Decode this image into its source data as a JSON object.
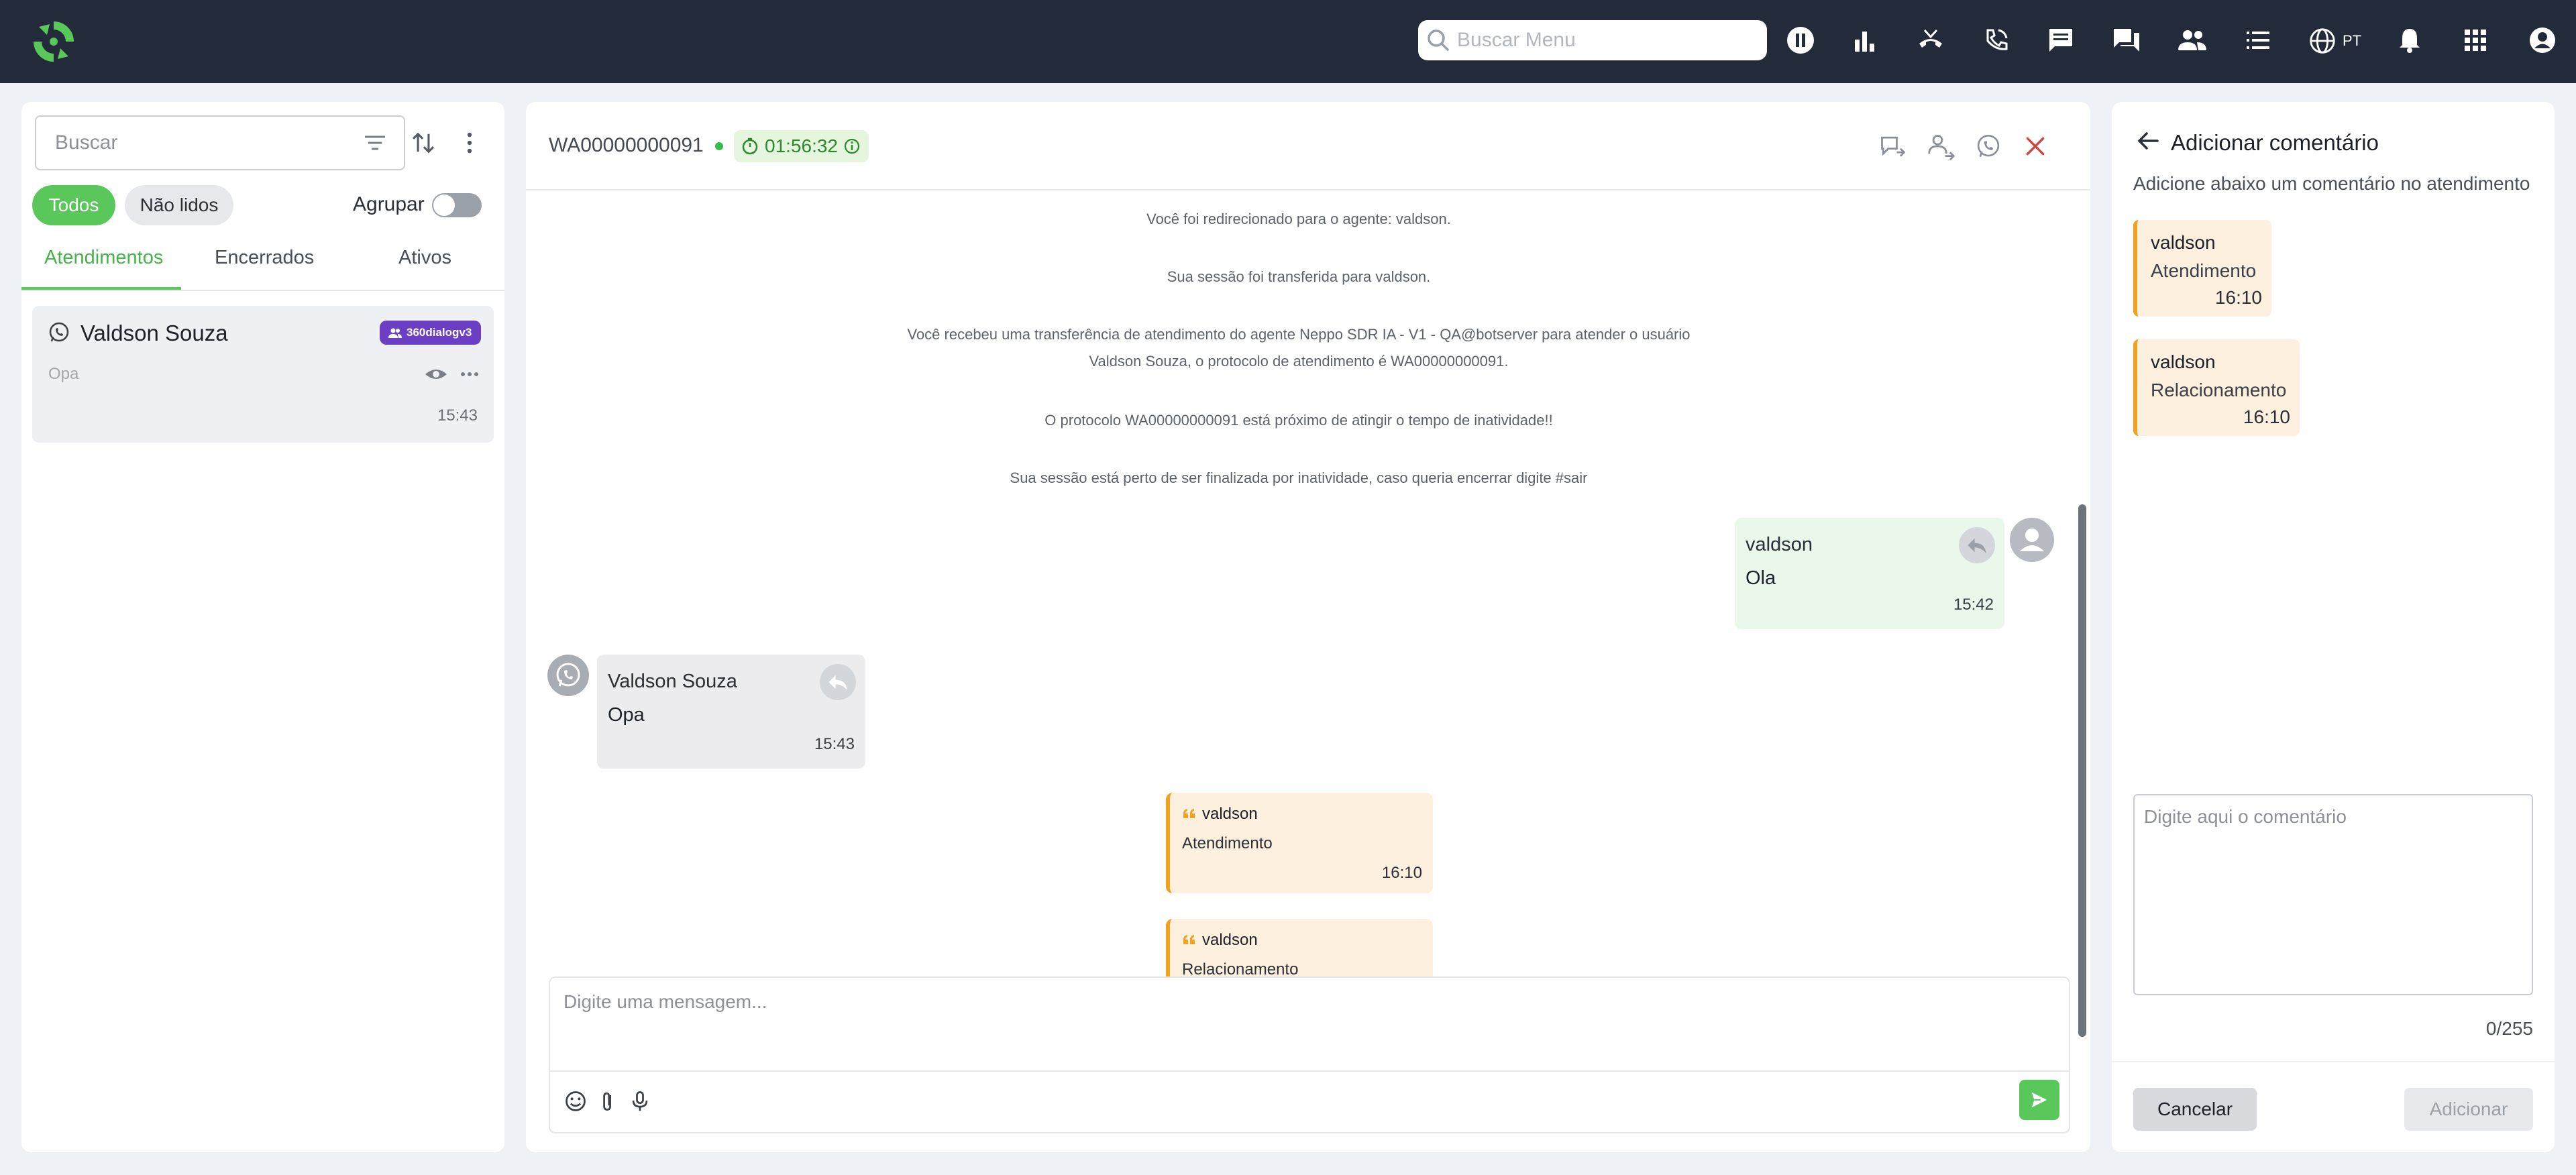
{
  "topbar": {
    "search_placeholder": "Buscar Menu",
    "language": "PT",
    "icons": [
      "pause-icon",
      "bar-chart-icon",
      "hangup-icon",
      "phone-call-icon",
      "chat-icon",
      "chats-icon",
      "people-icon",
      "list-icon",
      "globe-icon",
      "bell-icon",
      "apps-grid-icon",
      "account-icon"
    ]
  },
  "left": {
    "search_placeholder": "Buscar",
    "filters": {
      "all": "Todos",
      "unread": "Não lidos"
    },
    "group_label": "Agrupar",
    "group_enabled": false,
    "tabs": [
      "Atendimentos",
      "Encerrados",
      "Ativos"
    ],
    "active_tab": 0,
    "conversation": {
      "name": "Valdson Souza",
      "badge": "360dialogv3",
      "preview": "Opa",
      "time": "15:43"
    }
  },
  "chat": {
    "protocol": "WA00000000091",
    "timer": "01:56:32",
    "system_messages": [
      "Você foi redirecionado para o agente: valdson.",
      "Sua sessão foi transferida para valdson.",
      "Você recebeu uma transferência de atendimento do agente Neppo SDR IA - V1 - QA@botserver para atender o usuário",
      "Valdson Souza, o protocolo de atendimento é WA00000000091.",
      "O protocolo WA00000000091 está próximo de atingir o tempo de inatividade!!",
      "Sua sessão está perto de ser finalizada por inatividade, caso queria encerrar digite #sair"
    ],
    "agent_message": {
      "author": "valdson",
      "text": "Ola",
      "time": "15:42"
    },
    "client_message": {
      "author": "Valdson Souza",
      "text": "Opa",
      "time": "15:43"
    },
    "notes": [
      {
        "author": "valdson",
        "text": "Atendimento",
        "time": "16:10"
      },
      {
        "author": "valdson",
        "text": "Relacionamento"
      }
    ],
    "composer_placeholder": "Digite uma mensagem..."
  },
  "comment_panel": {
    "title": "Adicionar comentário",
    "subtitle": "Adicione abaixo um comentário no atendimento",
    "comments": [
      {
        "author": "valdson",
        "text": "Atendimento",
        "time": "16:10"
      },
      {
        "author": "valdson",
        "text": "Relacionamento",
        "time": "16:10"
      }
    ],
    "textarea_placeholder": "Digite aqui o comentário",
    "counter": "0/255",
    "cancel_label": "Cancelar",
    "add_label": "Adicionar"
  },
  "colors": {
    "topbar": "#232b3a",
    "accent_green": "#5ac75a",
    "badge_purple": "#6b3fc4",
    "note_orange": "#f1a223",
    "close_red": "#d9403a"
  }
}
